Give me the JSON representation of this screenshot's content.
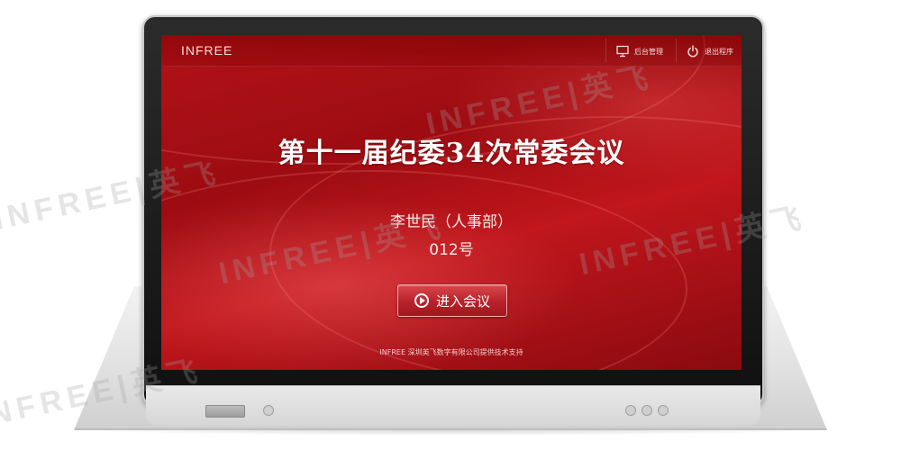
{
  "app": {
    "brand": "INFREE",
    "toolbar": {
      "admin_label": "后台管理",
      "exit_label": "退出程序"
    }
  },
  "meeting": {
    "title": "第十一届纪委34次常委会议",
    "attendee": "李世民（人事部）",
    "seat_number": "012号",
    "enter_button_label": "进入会议"
  },
  "footer": {
    "text": "INFREE  深圳英飞数字有限公司提供技术支持"
  },
  "watermark": {
    "text": "INFREE|英飞"
  },
  "colors": {
    "screen_red": "#a3161d",
    "button_red": "#b8222a",
    "text_white": "#ffffff"
  },
  "icons": {
    "admin": "monitor-icon",
    "exit": "power-icon",
    "enter": "play-circle-icon"
  }
}
